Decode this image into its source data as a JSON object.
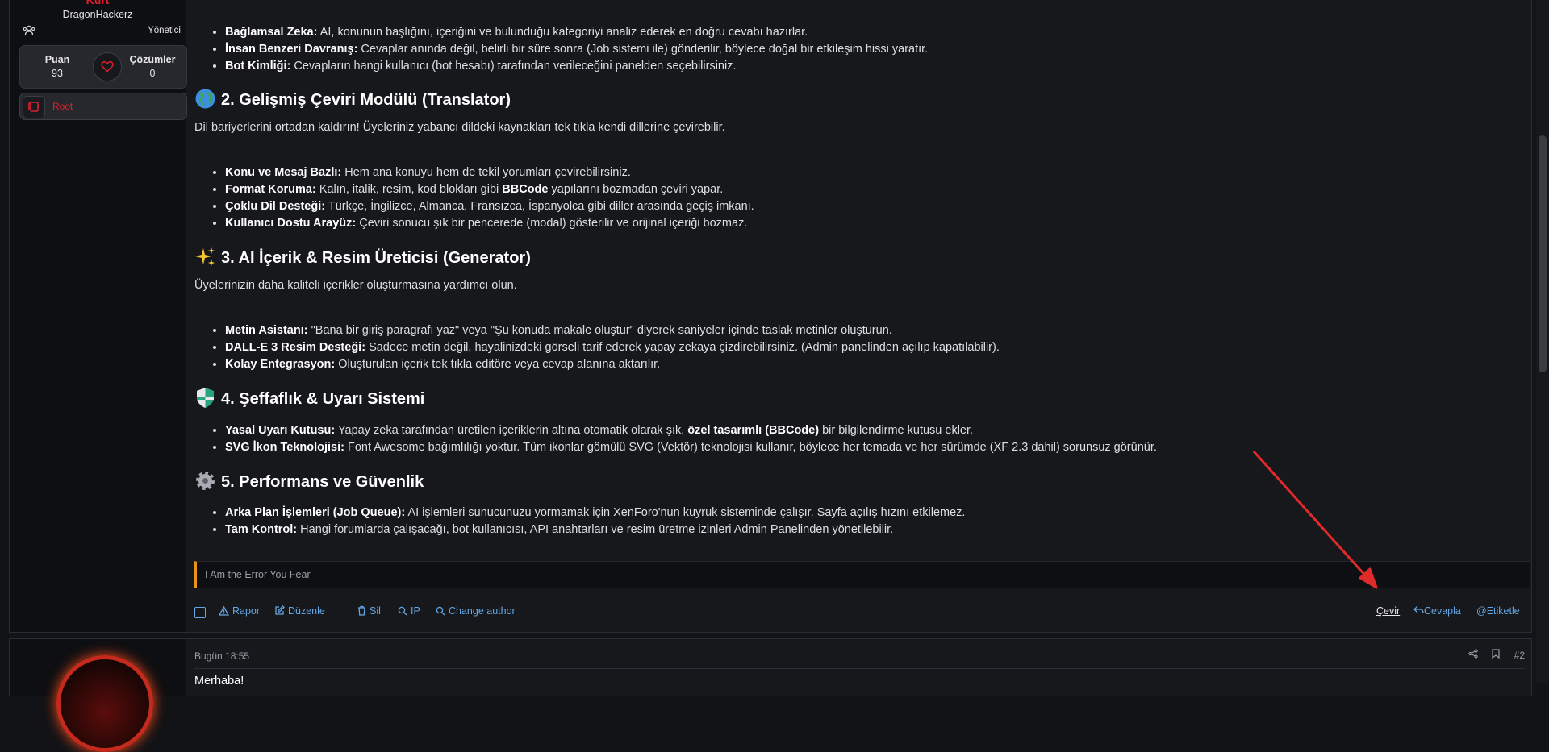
{
  "user": {
    "title_top": "Kurt",
    "username": "DragonHackerz",
    "role": "Yönetici",
    "stats": {
      "points_label": "Puan",
      "points_value": "93",
      "solutions_label": "Çözümler",
      "solutions_value": "0"
    },
    "badge": "Root"
  },
  "post": {
    "intro_items": [
      {
        "bold": "Bağlamsal Zeka:",
        "text": " AI, konunun başlığını, içeriğini ve bulunduğu kategoriyi analiz ederek en doğru cevabı hazırlar."
      },
      {
        "bold": "İnsan Benzeri Davranış:",
        "text": " Cevaplar anında değil, belirli bir süre sonra (Job sistemi ile) gönderilir, böylece doğal bir etkileşim hissi yaratır."
      },
      {
        "bold": "Bot Kimliği:",
        "text": " Cevapların hangi kullanıcı (bot hesabı) tarafından verileceğini panelden seçebilirsiniz."
      }
    ],
    "s2": {
      "title": "2. Gelişmiş Çeviri Modülü (Translator)",
      "desc": "Dil bariyerlerini ortadan kaldırın! Üyeleriniz yabancı dildeki kaynakları tek tıkla kendi dillerine çevirebilir.",
      "items": [
        {
          "bold": "Konu ve Mesaj Bazlı:",
          "text": " Hem ana konuyu hem de tekil yorumları çevirebilirsiniz."
        },
        {
          "bold": "Format Koruma:",
          "text": " Kalın, italik, resim, kod blokları gibi ",
          "bold2": "BBCode",
          "text2": " yapılarını bozmadan çeviri yapar."
        },
        {
          "bold": "Çoklu Dil Desteği:",
          "text": " Türkçe, İngilizce, Almanca, Fransızca, İspanyolca gibi diller arasında geçiş imkanı."
        },
        {
          "bold": "Kullanıcı Dostu Arayüz:",
          "text": " Çeviri sonucu şık bir pencerede (modal) gösterilir ve orijinal içeriği bozmaz."
        }
      ]
    },
    "s3": {
      "title": "3. AI İçerik & Resim Üreticisi (Generator)",
      "desc": "Üyelerinizin daha kaliteli içerikler oluşturmasına yardımcı olun.",
      "items": [
        {
          "bold": "Metin Asistanı:",
          "text": " \"Bana bir giriş paragrafı yaz\" veya \"Şu konuda makale oluştur\" diyerek saniyeler içinde taslak metinler oluşturun."
        },
        {
          "bold": "DALL-E 3 Resim Desteği:",
          "text": " Sadece metin değil, hayalinizdeki görseli tarif ederek yapay zekaya çizdirebilirsiniz. (Admin panelinden açılıp kapatılabilir)."
        },
        {
          "bold": "Kolay Entegrasyon:",
          "text": " Oluşturulan içerik tek tıkla editöre veya cevap alanına aktarılır."
        }
      ]
    },
    "s4": {
      "title": "4. Şeffaflık & Uyarı Sistemi",
      "items": [
        {
          "bold": "Yasal Uyarı Kutusu:",
          "text": " Yapay zeka tarafından üretilen içeriklerin altına otomatik olarak şık, ",
          "bold2": "özel tasarımlı (BBCode)",
          "text2": " bir bilgilendirme kutusu ekler."
        },
        {
          "bold": "SVG İkon Teknolojisi:",
          "text": " Font Awesome bağımlılığı yoktur. Tüm ikonlar gömülü SVG (Vektör) teknolojisi kullanır, böylece her temada ve her sürümde (XF 2.3 dahil) sorunsuz görünür."
        }
      ]
    },
    "s5": {
      "title": "5. Performans ve Güvenlik",
      "items": [
        {
          "bold": "Arka Plan İşlemleri (Job Queue):",
          "text": " AI işlemleri sunucunuzu yormamak için XenForo'nun kuyruk sisteminde çalışır. Sayfa açılış hızını etkilemez."
        },
        {
          "bold": "Tam Kontrol:",
          "text": " Hangi forumlarda çalışacağı, bot kullanıcısı, API anahtarları ve resim üretme izinleri Admin Panelinden yönetilebilir."
        }
      ]
    },
    "signature": "I Am the Error You Fear"
  },
  "actions": {
    "report": "Rapor",
    "edit": "Düzenle",
    "delete": "Sil",
    "ip": "IP",
    "change_author": "Change author",
    "translate": "Çevir",
    "reply": "Cevapla",
    "tag": "@Etiketle"
  },
  "post2": {
    "time": "Bugün 18:55",
    "number": "#2",
    "body": "Merhaba!"
  }
}
